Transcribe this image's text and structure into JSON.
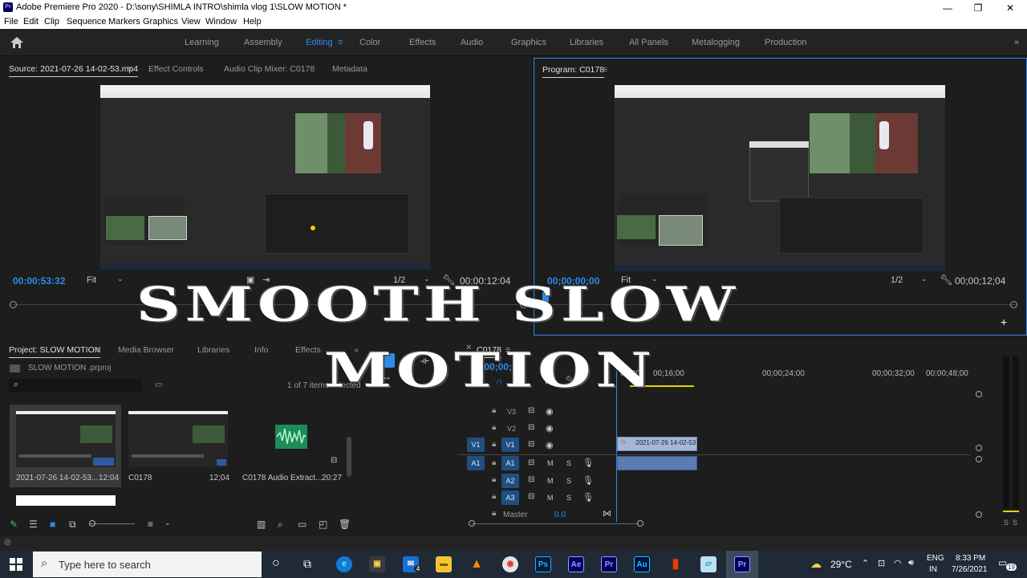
{
  "window": {
    "title": "Adobe Premiere Pro 2020 - D:\\sony\\SHIMLA INTRO\\shimla vlog 1\\SLOW MOTION *",
    "minimize": "—",
    "maximize": "❐",
    "close": "✕"
  },
  "menu": [
    "File",
    "Edit",
    "Clip",
    "Sequence",
    "Markers",
    "Graphics",
    "View",
    "Window",
    "Help"
  ],
  "workspaces": {
    "items": [
      "Learning",
      "Assembly",
      "Editing",
      "Color",
      "Effects",
      "Audio",
      "Graphics",
      "Libraries",
      "All Panels",
      "Metalogging",
      "Production"
    ],
    "active": "Editing"
  },
  "source": {
    "tabs": [
      "Source: 2021-07-26 14-02-53.mp4",
      "Effect Controls",
      "Audio Clip Mixer: C0178",
      "Metadata"
    ],
    "timecode": "00:00:53:32",
    "fit": "Fit",
    "resolution": "1/2",
    "duration": "00:00:12:04"
  },
  "program": {
    "tab": "Program: C0178",
    "timecode": "00;00;00;00",
    "fit": "Fit",
    "resolution": "1/2",
    "duration": "00;00;12;04"
  },
  "project": {
    "tabs": [
      "Project: SLOW MOTION",
      "Media Browser",
      "Libraries",
      "Info",
      "Effects"
    ],
    "file": "SLOW MOTION .prproj",
    "count": "1 of 7 items selected",
    "items": [
      {
        "name": "2021-07-26 14-02-53...",
        "duration": "12:04"
      },
      {
        "name": "C0178",
        "duration": "12;04"
      },
      {
        "name": "C0178 Audio Extract...",
        "duration": "20:27"
      }
    ]
  },
  "timeline": {
    "tab": "C0178",
    "timecode": "00;00;00;00",
    "ruler": [
      "00;00",
      "00;16;00",
      "00;00;24;00",
      "00;00;32;00",
      "00;00;40;00",
      "00;00;48;00"
    ],
    "video_tracks": [
      "V3",
      "V2",
      "V1"
    ],
    "audio_tracks": [
      "A1",
      "A2",
      "A3"
    ],
    "master": "Master",
    "master_value": "0.0",
    "clip_name": "2021-07-26 14-02-53",
    "mute": "M",
    "solo": "S"
  },
  "overlay": {
    "line1": "SMOOTH SLOW",
    "line2": "MOTION"
  },
  "taskbar": {
    "search_placeholder": "Type here to search",
    "apps": [
      "Ps",
      "Ae",
      "Pr",
      "Au",
      "Pr"
    ],
    "weather": "29°C",
    "lang1": "ENG",
    "lang2": "IN",
    "time": "8:33 PM",
    "date": "7/26/2021",
    "notifications": "19",
    "mail_badge": "4"
  },
  "colors": {
    "accent": "#2d8ceb",
    "panel": "#1d1d1d"
  }
}
